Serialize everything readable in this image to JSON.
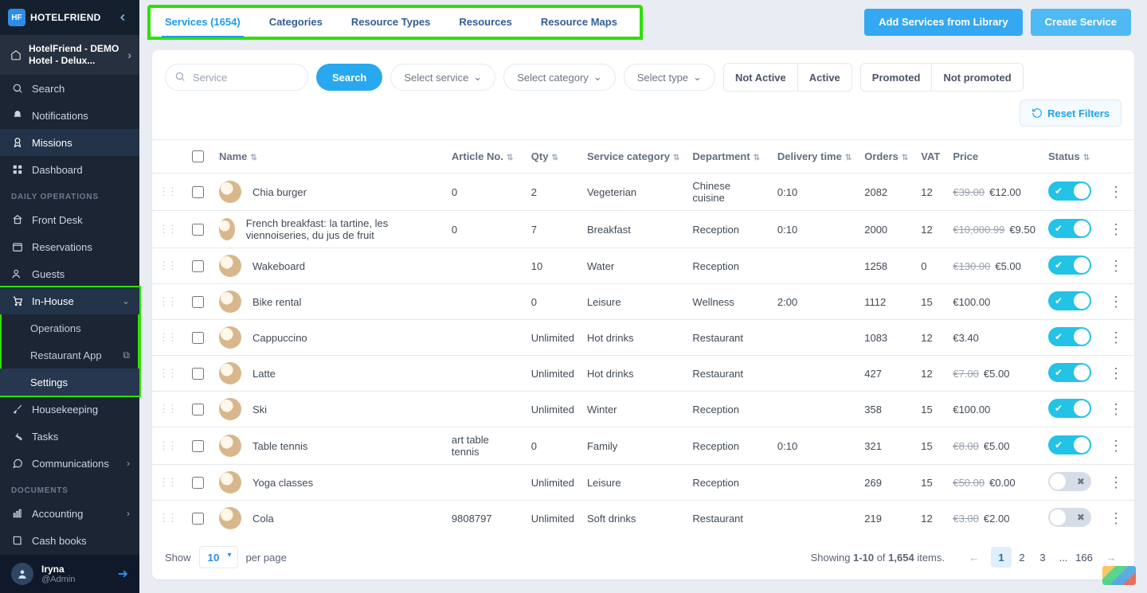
{
  "brand": "HOTELFRIEND",
  "hotel": "HotelFriend - DEMO Hotel - Delux...",
  "sidebar": {
    "search": "Search",
    "notifications": "Notifications",
    "missions": "Missions",
    "dashboard": "Dashboard",
    "section_daily": "DAILY OPERATIONS",
    "front_desk": "Front Desk",
    "reservations": "Reservations",
    "guests": "Guests",
    "in_house": "In-House",
    "operations": "Operations",
    "restaurant_app": "Restaurant App",
    "settings": "Settings",
    "housekeeping": "Housekeeping",
    "tasks": "Tasks",
    "communications": "Communications",
    "section_docs": "DOCUMENTS",
    "accounting": "Accounting",
    "cash_books": "Cash books"
  },
  "user": {
    "name": "Iryna",
    "role": "@Admin"
  },
  "tabs": {
    "services": "Services (1654)",
    "categories": "Categories",
    "resource_types": "Resource Types",
    "resources": "Resources",
    "resource_maps": "Resource Maps"
  },
  "top_buttons": {
    "add_from_library": "Add Services from Library",
    "create_service": "Create Service"
  },
  "filters": {
    "placeholder": "Service",
    "search_btn": "Search",
    "select_service": "Select service",
    "select_category": "Select category",
    "select_type": "Select type",
    "not_active": "Not Active",
    "active": "Active",
    "promoted": "Promoted",
    "not_promoted": "Not promoted",
    "reset": "Reset Filters"
  },
  "columns": {
    "name": "Name",
    "article": "Article No.",
    "qty": "Qty",
    "category": "Service category",
    "department": "Department",
    "delivery": "Delivery time",
    "orders": "Orders",
    "vat": "VAT",
    "price": "Price",
    "status": "Status"
  },
  "rows": [
    {
      "name": "Chia burger",
      "article": "0",
      "qty": "2",
      "category": "Vegeterian",
      "department": "Chinese cuisine",
      "delivery": "0:10",
      "orders": "2082",
      "vat": "12",
      "price_old": "€39.00",
      "price": "€12.00",
      "status": true
    },
    {
      "name": "French breakfast: la tartine, les viennoiseries, du jus de fruit",
      "article": "0",
      "qty": "7",
      "category": "Breakfast",
      "department": "Reception",
      "delivery": "0:10",
      "orders": "2000",
      "vat": "12",
      "price_old": "€10,000.99",
      "price": "€9.50",
      "status": true
    },
    {
      "name": "Wakeboard",
      "article": "",
      "qty": "10",
      "category": "Water",
      "department": "Reception",
      "delivery": "",
      "orders": "1258",
      "vat": "0",
      "price_old": "€130.00",
      "price": "€5.00",
      "status": true
    },
    {
      "name": "Bike rental",
      "article": "",
      "qty": "0",
      "category": "Leisure",
      "department": "Wellness",
      "delivery": "2:00",
      "orders": "1112",
      "vat": "15",
      "price_old": "",
      "price": "€100.00",
      "status": true
    },
    {
      "name": "Cappuccino",
      "article": "",
      "qty": "Unlimited",
      "category": "Hot drinks",
      "department": "Restaurant",
      "delivery": "",
      "orders": "1083",
      "vat": "12",
      "price_old": "",
      "price": "€3.40",
      "status": true
    },
    {
      "name": "Latte",
      "article": "",
      "qty": "Unlimited",
      "category": "Hot drinks",
      "department": "Restaurant",
      "delivery": "",
      "orders": "427",
      "vat": "12",
      "price_old": "€7.00",
      "price": "€5.00",
      "status": true
    },
    {
      "name": "Ski",
      "article": "",
      "qty": "Unlimited",
      "category": "Winter",
      "department": "Reception",
      "delivery": "",
      "orders": "358",
      "vat": "15",
      "price_old": "",
      "price": "€100.00",
      "status": true
    },
    {
      "name": "Table tennis",
      "article": "art table tennis",
      "qty": "0",
      "category": "Family",
      "department": "Reception",
      "delivery": "0:10",
      "orders": "321",
      "vat": "15",
      "price_old": "€8.00",
      "price": "€5.00",
      "status": true
    },
    {
      "name": "Yoga classes",
      "article": "",
      "qty": "Unlimited",
      "category": "Leisure",
      "department": "Reception",
      "delivery": "",
      "orders": "269",
      "vat": "15",
      "price_old": "€50.00",
      "price": "€0.00",
      "status": false
    },
    {
      "name": "Cola",
      "article": "9808797",
      "qty": "Unlimited",
      "category": "Soft drinks",
      "department": "Restaurant",
      "delivery": "",
      "orders": "219",
      "vat": "12",
      "price_old": "€3.00",
      "price": "€2.00",
      "status": false
    }
  ],
  "pagination": {
    "show": "Show",
    "per_page": "per page",
    "size": "10",
    "summary_pre": "Showing ",
    "summary_range": "1-10",
    "summary_mid": " of ",
    "summary_total": "1,654",
    "summary_post": " items.",
    "pages": [
      "1",
      "2",
      "3",
      "...",
      "166"
    ]
  }
}
